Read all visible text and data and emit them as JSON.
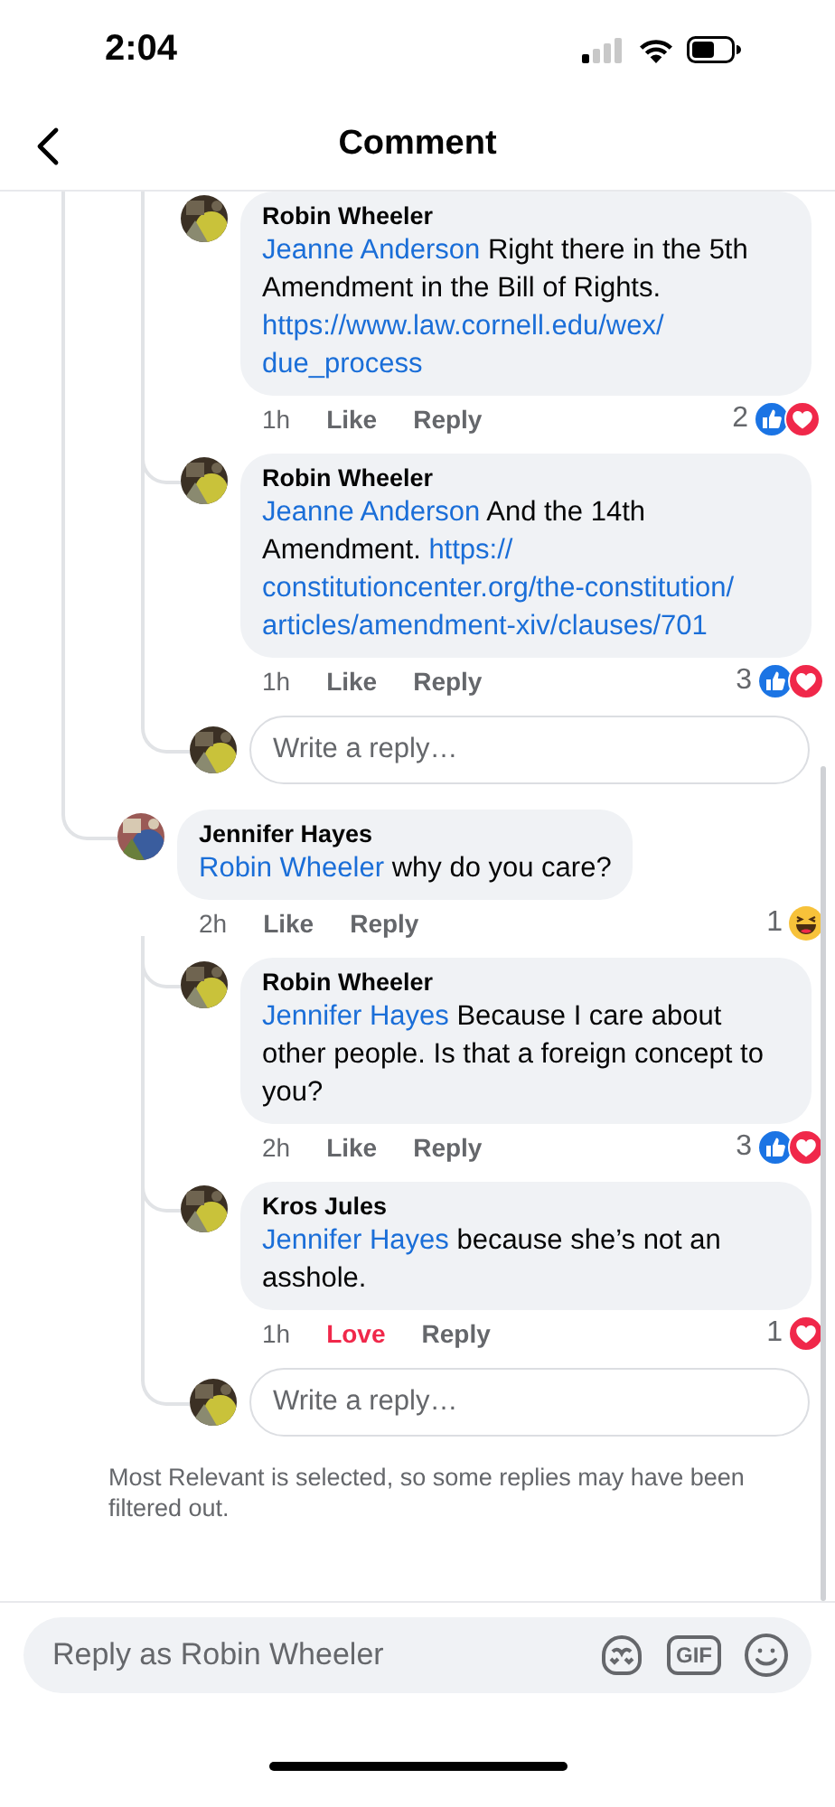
{
  "status_bar": {
    "time": "2:04"
  },
  "header": {
    "title": "Comment"
  },
  "earlier_replies": [
    {
      "avatar": {
        "kind": "picture"
      },
      "author": "Robin Wheeler",
      "body": [
        {
          "kind": "mention",
          "text": "Jeanne Anderson"
        },
        {
          "kind": "text",
          "text": " Right there in the 5th Amendment in the Bill of Rights. "
        },
        {
          "kind": "link",
          "text": "https://www.law.cornell.edu/wex/"
        },
        {
          "kind": "link",
          "text": "due_process"
        }
      ],
      "time": "1h",
      "reaction": {
        "label": "Like",
        "reacted": false
      },
      "reply_label": "Reply",
      "reactions": {
        "count": "2",
        "icons": [
          {
            "kind": "like"
          },
          {
            "kind": "love"
          }
        ]
      }
    },
    {
      "avatar": {
        "kind": "picture"
      },
      "author": "Robin Wheeler",
      "body": [
        {
          "kind": "mention",
          "text": "Jeanne Anderson"
        },
        {
          "kind": "text",
          "text": " And the 14th Amendment. "
        },
        {
          "kind": "link",
          "text": "https://"
        },
        {
          "kind": "link",
          "text": "constitutioncenter.org/the-constitution/"
        },
        {
          "kind": "link",
          "text": "articles/amendment-xiv/clauses/701"
        }
      ],
      "time": "1h",
      "reaction": {
        "label": "Like",
        "reacted": false
      },
      "reply_label": "Reply",
      "reactions": {
        "count": "3",
        "icons": [
          {
            "kind": "like"
          },
          {
            "kind": "love"
          }
        ]
      }
    }
  ],
  "earlier_reply_box": {
    "avatar": {
      "kind": "picture"
    },
    "placeholder": "Write a reply…"
  },
  "comment": {
    "avatar": {
      "kind": "picture"
    },
    "author": "Jennifer Hayes",
    "body": [
      {
        "kind": "mention",
        "text": "Robin Wheeler"
      },
      {
        "kind": "text",
        "text": " why do you care?"
      }
    ],
    "time": "2h",
    "reaction": {
      "label": "Like",
      "reacted": false
    },
    "reply_label": "Reply",
    "reactions": {
      "count": "1",
      "icons": [
        {
          "kind": "haha"
        }
      ]
    },
    "replies": [
      {
        "avatar": {
          "kind": "picture"
        },
        "author": "Robin Wheeler",
        "body": [
          {
            "kind": "mention",
            "text": "Jennifer Hayes"
          },
          {
            "kind": "text",
            "text": " Because I care about other people. Is that a foreign concept to you?"
          }
        ],
        "time": "2h",
        "reaction": {
          "label": "Like",
          "reacted": false
        },
        "reply_label": "Reply",
        "reactions": {
          "count": "3",
          "icons": [
            {
              "kind": "like"
            },
            {
              "kind": "love"
            }
          ]
        }
      },
      {
        "avatar": {
          "kind": "picture"
        },
        "author": "Kros Jules",
        "body": [
          {
            "kind": "mention",
            "text": "Jennifer Hayes"
          },
          {
            "kind": "text",
            "text": " because she’s not an asshole."
          }
        ],
        "time": "1h",
        "reaction": {
          "label": "Love",
          "reacted": true
        },
        "reply_label": "Reply",
        "reactions": {
          "count": "1",
          "icons": [
            {
              "kind": "love"
            }
          ]
        }
      }
    ],
    "reply_box": {
      "avatar": {
        "kind": "picture"
      },
      "placeholder": "Write a reply…"
    }
  },
  "filter_note": "Most Relevant is selected, so some replies may have been filtered out.",
  "composer": {
    "placeholder": "Reply as Robin Wheeler",
    "gif_label": "GIF"
  }
}
